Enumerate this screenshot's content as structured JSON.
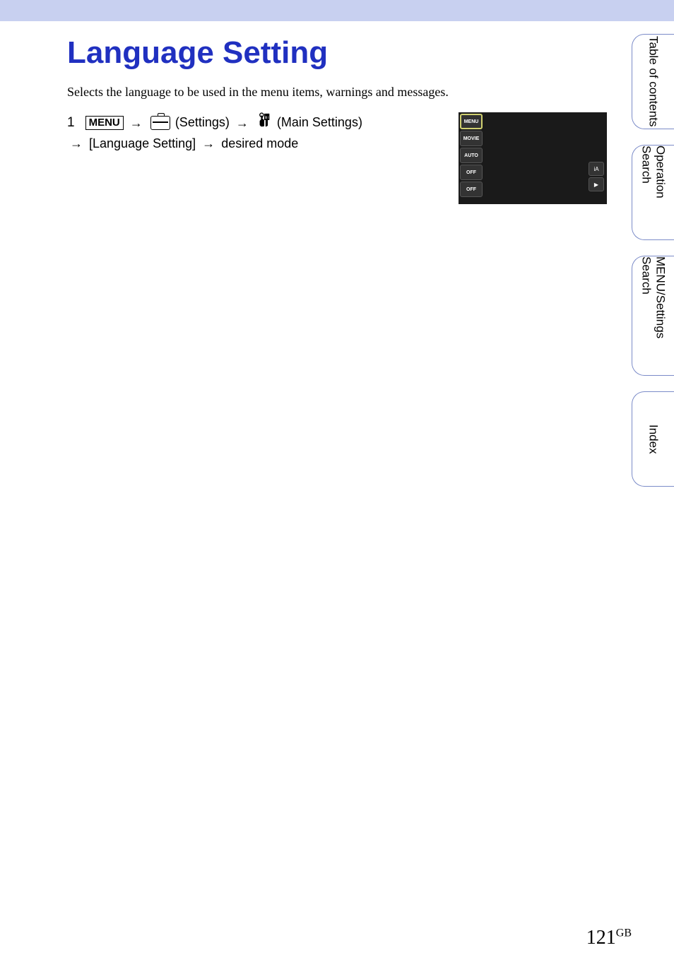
{
  "page": {
    "title": "Language Setting",
    "description": "Selects the language to be used in the menu items, warnings and messages."
  },
  "instruction": {
    "step_number": "1",
    "menu_label": "MENU",
    "settings_label": "(Settings)",
    "main_settings_label": "(Main Settings)",
    "language_setting_label": "[Language Setting]",
    "desired_mode_label": "desired mode"
  },
  "screen": {
    "left_icons": [
      "MENU",
      "MOVIE",
      "AUTO",
      "OFF",
      "OFF"
    ],
    "right_icons": [
      "iA",
      "▶"
    ]
  },
  "side_tabs": [
    {
      "label": "Table of contents"
    },
    {
      "label": "Operation Search"
    },
    {
      "label": "MENU/Settings Search"
    },
    {
      "label": "Index"
    }
  ],
  "footer": {
    "page_number": "121",
    "suffix": "GB"
  }
}
